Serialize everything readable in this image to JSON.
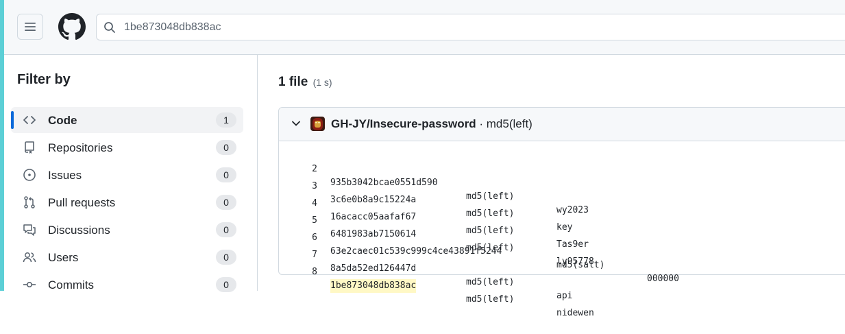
{
  "header": {
    "search": {
      "value": "1be873048db838ac"
    }
  },
  "sidebar": {
    "title": "Filter by",
    "items": [
      {
        "label": "Code",
        "count": "1",
        "icon": "code-icon",
        "active": true
      },
      {
        "label": "Repositories",
        "count": "0",
        "icon": "repo-icon"
      },
      {
        "label": "Issues",
        "count": "0",
        "icon": "issue-icon"
      },
      {
        "label": "Pull requests",
        "count": "0",
        "icon": "pull-request-icon"
      },
      {
        "label": "Discussions",
        "count": "0",
        "icon": "discussion-icon"
      },
      {
        "label": "Users",
        "count": "0",
        "icon": "people-icon"
      },
      {
        "label": "Commits",
        "count": "0",
        "icon": "commit-icon"
      }
    ]
  },
  "main": {
    "result_count": "1 file",
    "result_time": "(1 s)",
    "result": {
      "repo": "GH-JY/Insecure-password",
      "separator": "·",
      "file": "md5(left)",
      "lines": [
        {
          "num": "2",
          "hash": "935b3042bcae0551d590",
          "algo": "md5(left)",
          "plain": "wy2023",
          "extra": ""
        },
        {
          "num": "3",
          "hash": "3c6e0b8a9c15224a",
          "algo": "md5(left)",
          "plain": "key",
          "extra": ""
        },
        {
          "num": "4",
          "hash": "16acacc05aafaf67",
          "algo": "md5(left)",
          "plain": "Tas9er",
          "extra": ""
        },
        {
          "num": "5",
          "hash": "6481983ab7150614",
          "algo": "md5(left)",
          "plain": "ly95778",
          "extra": ""
        },
        {
          "num": "6",
          "hash": "63e2caec01c539c999c4ce43891f5244",
          "algo": "",
          "plain": "md5(salt)",
          "extra": "000000"
        },
        {
          "num": "7",
          "hash": "8a5da52ed126447d",
          "algo": "md5(left)",
          "plain": "api",
          "extra": ""
        },
        {
          "num": "8",
          "hash": "1be873048db838ac",
          "algo": "md5(left)",
          "plain": "nidewen",
          "extra": "",
          "highlight": true
        }
      ]
    }
  },
  "colors": {
    "accent": "#0969da",
    "highlight": "#fff8c5",
    "left_strip": "#5ccfd6"
  }
}
